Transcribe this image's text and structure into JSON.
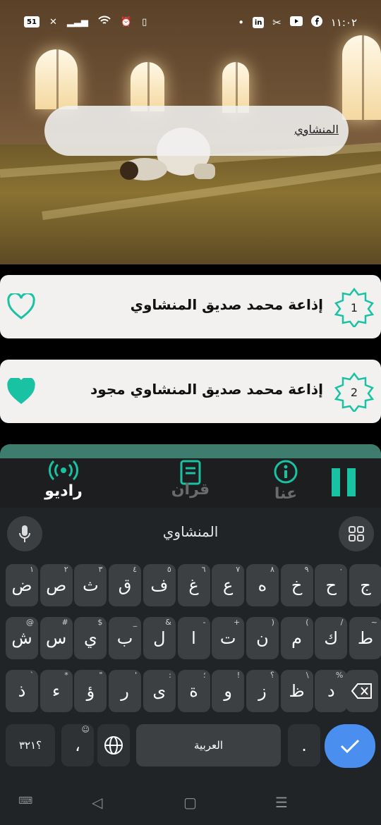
{
  "status_bar": {
    "time": "١١:٠٢",
    "left_icons": [
      "battery-icon",
      "x-icon",
      "signal-icon",
      "wifi-icon",
      "alarm-icon",
      "vibrate-icon"
    ],
    "right_icons": [
      "dot-icon",
      "linkedin-icon",
      "tools-icon",
      "youtube-icon",
      "facebook-icon"
    ],
    "battery_label": "51"
  },
  "search": {
    "query": "المنشاوي"
  },
  "stations": [
    {
      "number": "1",
      "title": "إذاعة محمد صديق المنشاوي",
      "favorite": false
    },
    {
      "number": "2",
      "title": "إذاعة محمد صديق المنشاوي مجود",
      "favorite": true
    }
  ],
  "bottom_nav": {
    "tabs": [
      {
        "label": "راديو",
        "active": true
      },
      {
        "label": "قران",
        "active": false
      },
      {
        "label": "عنا",
        "active": false
      }
    ]
  },
  "keyboard": {
    "suggestion": "المنشاوي",
    "row1": [
      {
        "k": "ض",
        "h": "١"
      },
      {
        "k": "ص",
        "h": "٢"
      },
      {
        "k": "ث",
        "h": "٣"
      },
      {
        "k": "ق",
        "h": "٤"
      },
      {
        "k": "ف",
        "h": "٥"
      },
      {
        "k": "غ",
        "h": "٦"
      },
      {
        "k": "ع",
        "h": "٧"
      },
      {
        "k": "ه",
        "h": "٨"
      },
      {
        "k": "خ",
        "h": "٩"
      },
      {
        "k": "ح",
        "h": "٠"
      },
      {
        "k": "ج",
        "h": ""
      }
    ],
    "row2": [
      {
        "k": "ش",
        "h": "@"
      },
      {
        "k": "س",
        "h": "#"
      },
      {
        "k": "ي",
        "h": "$"
      },
      {
        "k": "ب",
        "h": "_"
      },
      {
        "k": "ل",
        "h": "&"
      },
      {
        "k": "ا",
        "h": "-"
      },
      {
        "k": "ت",
        "h": "+"
      },
      {
        "k": "ن",
        "h": "("
      },
      {
        "k": "م",
        "h": ")"
      },
      {
        "k": "ك",
        "h": "/"
      },
      {
        "k": "ط",
        "h": "~"
      }
    ],
    "row3": [
      {
        "k": "ذ",
        "h": "`"
      },
      {
        "k": "ء",
        "h": "*"
      },
      {
        "k": "ؤ",
        "h": "\""
      },
      {
        "k": "ر",
        "h": "'"
      },
      {
        "k": "ى",
        "h": ":"
      },
      {
        "k": "ة",
        "h": "؛"
      },
      {
        "k": "و",
        "h": "!"
      },
      {
        "k": "ز",
        "h": "؟"
      },
      {
        "k": "ظ",
        "h": "\\"
      },
      {
        "k": "د",
        "h": "%"
      }
    ],
    "symbols_key": "؟٣٢١",
    "comma_key": "،",
    "space_label": "العربية",
    "period_key": "."
  },
  "colors": {
    "accent": "#19c2a2",
    "card": "#f2f1ef",
    "keyboard_bg": "#202427",
    "enter": "#4a8ff0"
  }
}
